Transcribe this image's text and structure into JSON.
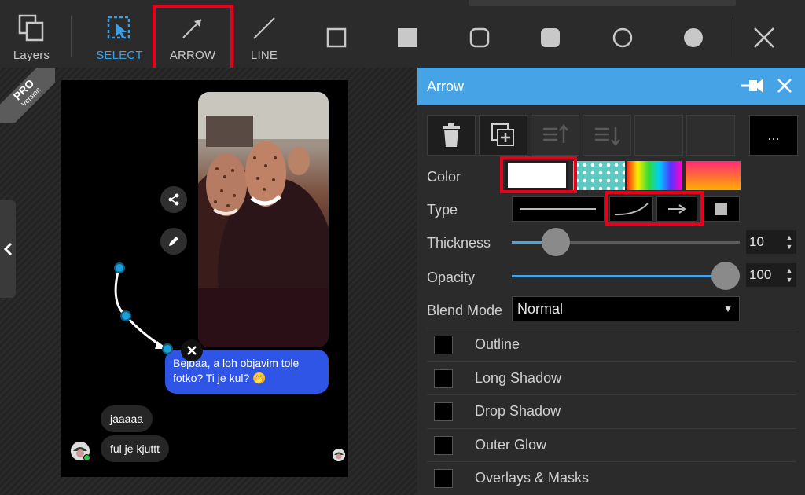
{
  "toolbar": {
    "tools": [
      {
        "id": "layers",
        "label": "Layers"
      },
      {
        "id": "select",
        "label": "SELECT"
      },
      {
        "id": "arrow",
        "label": "ARROW"
      },
      {
        "id": "line",
        "label": "LINE"
      }
    ],
    "shapes": [
      "square-outline-icon",
      "square-filled-icon",
      "rounded-square-outline-icon",
      "rounded-square-filled-icon",
      "circle-outline-icon",
      "circle-filled-icon"
    ],
    "accent": "#3aa0e8",
    "highlight": "#e8001a"
  },
  "badge": {
    "title": "PRO",
    "subtitle": "Version"
  },
  "chat": {
    "message_blue": "Bejbaa, a loh objavim tole fotko? Ti je kul? 🤭",
    "reply_1": "jaaaaa",
    "reply_2": "ful je kjuttt"
  },
  "panel": {
    "title": "Arrow",
    "color_label": "Color",
    "type_label": "Type",
    "thickness_label": "Thickness",
    "thickness_value": "10",
    "thickness_level": 0.15,
    "opacity_label": "Opacity",
    "opacity_value": "100",
    "opacity_level": 1.0,
    "blend_label": "Blend Mode",
    "blend_value": "Normal",
    "more_label": "...",
    "options": [
      "Outline",
      "Long Shadow",
      "Drop Shadow",
      "Outer Glow",
      "Overlays & Masks"
    ],
    "accent": "#46a4e6"
  }
}
